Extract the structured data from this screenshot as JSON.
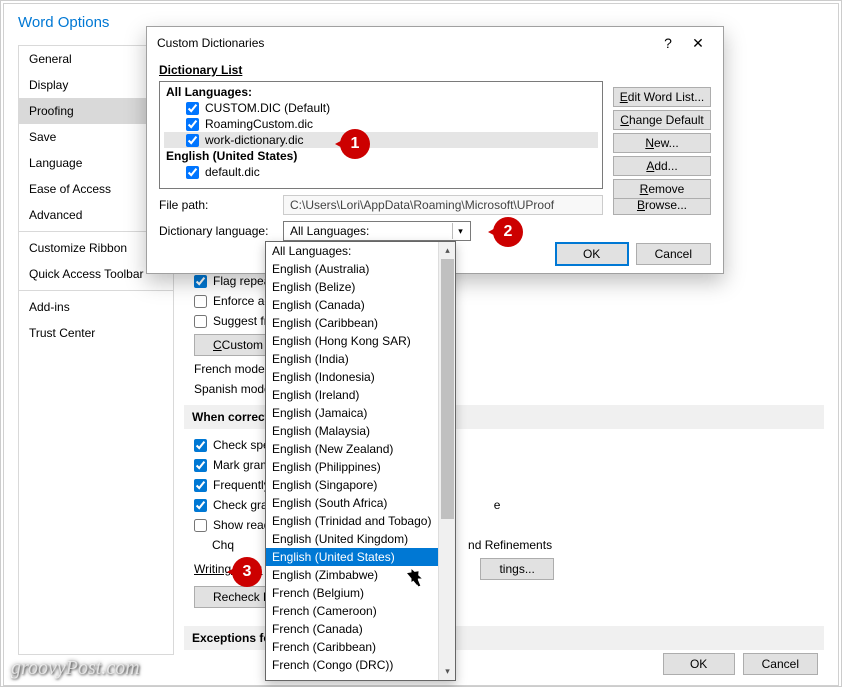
{
  "bg_window": {
    "title": "Word Options",
    "sidebar": [
      "General",
      "Display",
      "Proofing",
      "Save",
      "Language",
      "Ease of Access",
      "Advanced",
      "Customize Ribbon",
      "Quick Access Toolbar",
      "Add-ins",
      "Trust Center"
    ],
    "sidebar_selected": 2,
    "options_visible": {
      "flag_repeated": "Flag repeated",
      "enforce_acce": "Enforce acce",
      "suggest_from": "Suggest from",
      "custom_dict_btn": "Custom Dictio",
      "french_modes": "French modes:",
      "spanish_modes": "Spanish modes:",
      "section_when": "When correcting",
      "check_spelling": "Check spellin",
      "mark_gramm": "Mark gramm",
      "frequently": "Frequently c",
      "check_gramm2": "Check gramm",
      "show_readab": "Show readab",
      "chq_bullet": "Chq",
      "nd_ref": "nd Refinements",
      "writing_style": "Writing style:",
      "settings_btn": "tings...",
      "recheck": "Recheck Docu",
      "exceptions": "Exceptions for:",
      "line_e": "e"
    },
    "bottom_ok": "OK",
    "bottom_cancel": "Cancel"
  },
  "dialog": {
    "title": "Custom Dictionaries",
    "help_icon": "?",
    "close_icon": "✕",
    "list_label": "Dictionary List",
    "groups": [
      {
        "label": "All Languages:",
        "items": [
          {
            "label": "CUSTOM.DIC (Default)",
            "checked": true,
            "selected": false
          },
          {
            "label": "RoamingCustom.dic",
            "checked": true,
            "selected": false
          },
          {
            "label": "work-dictionary.dic",
            "checked": true,
            "selected": true
          }
        ]
      },
      {
        "label": "English (United States)",
        "items": [
          {
            "label": "default.dic",
            "checked": true,
            "selected": false
          }
        ]
      }
    ],
    "right_buttons": [
      "Edit Word List...",
      "Change Default",
      "New...",
      "Add...",
      "Remove"
    ],
    "file_path_label": "File path:",
    "file_path": "C:\\Users\\Lori\\AppData\\Roaming\\Microsoft\\UProof",
    "browse": "Browse...",
    "lang_label": "Dictionary language:",
    "lang_value": "All Languages:",
    "ok": "OK",
    "cancel": "Cancel"
  },
  "dropdown": {
    "items": [
      "All Languages:",
      "English (Australia)",
      "English (Belize)",
      "English (Canada)",
      "English (Caribbean)",
      "English (Hong Kong SAR)",
      "English (India)",
      "English (Indonesia)",
      "English (Ireland)",
      "English (Jamaica)",
      "English (Malaysia)",
      "English (New Zealand)",
      "English (Philippines)",
      "English (Singapore)",
      "English (South Africa)",
      "English (Trinidad and Tobago)",
      "English (United Kingdom)",
      "English (United States)",
      "English (Zimbabwe)",
      "French (Belgium)",
      "French (Cameroon)",
      "French (Canada)",
      "French (Caribbean)",
      "French (Congo (DRC))"
    ],
    "highlighted_index": 17
  },
  "callouts": [
    "1",
    "2",
    "3"
  ],
  "watermark": "groovyPost.com"
}
